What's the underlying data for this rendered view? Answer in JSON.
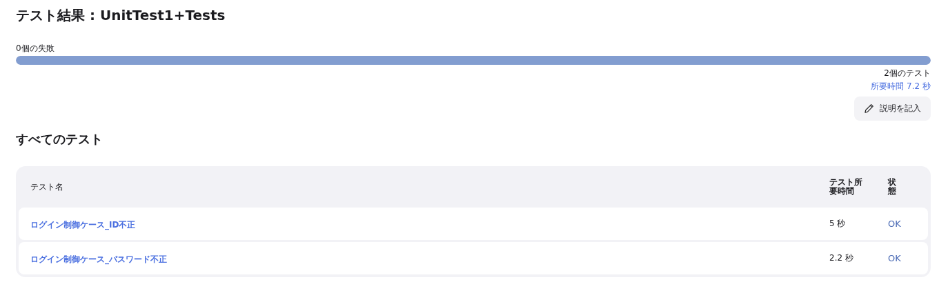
{
  "title": "テスト結果 : UnitTest1+Tests",
  "summary": {
    "failures": "0個の失敗",
    "level": 1,
    "count": "2個のテスト",
    "duration": "所要時間 7.2 秒"
  },
  "describe_button": "説明を記入",
  "section_title": "すべてのテスト",
  "table": {
    "columns": [
      "テスト名",
      "テスト所要時間",
      "状態"
    ],
    "rows": [
      {
        "name": "ログイン制御ケース_ID不正",
        "duration": "5 秒",
        "status": "OK"
      },
      {
        "name": "ログイン制御ケース_パスワード不正",
        "duration": "2.2 秒",
        "status": "OK"
      }
    ]
  }
}
